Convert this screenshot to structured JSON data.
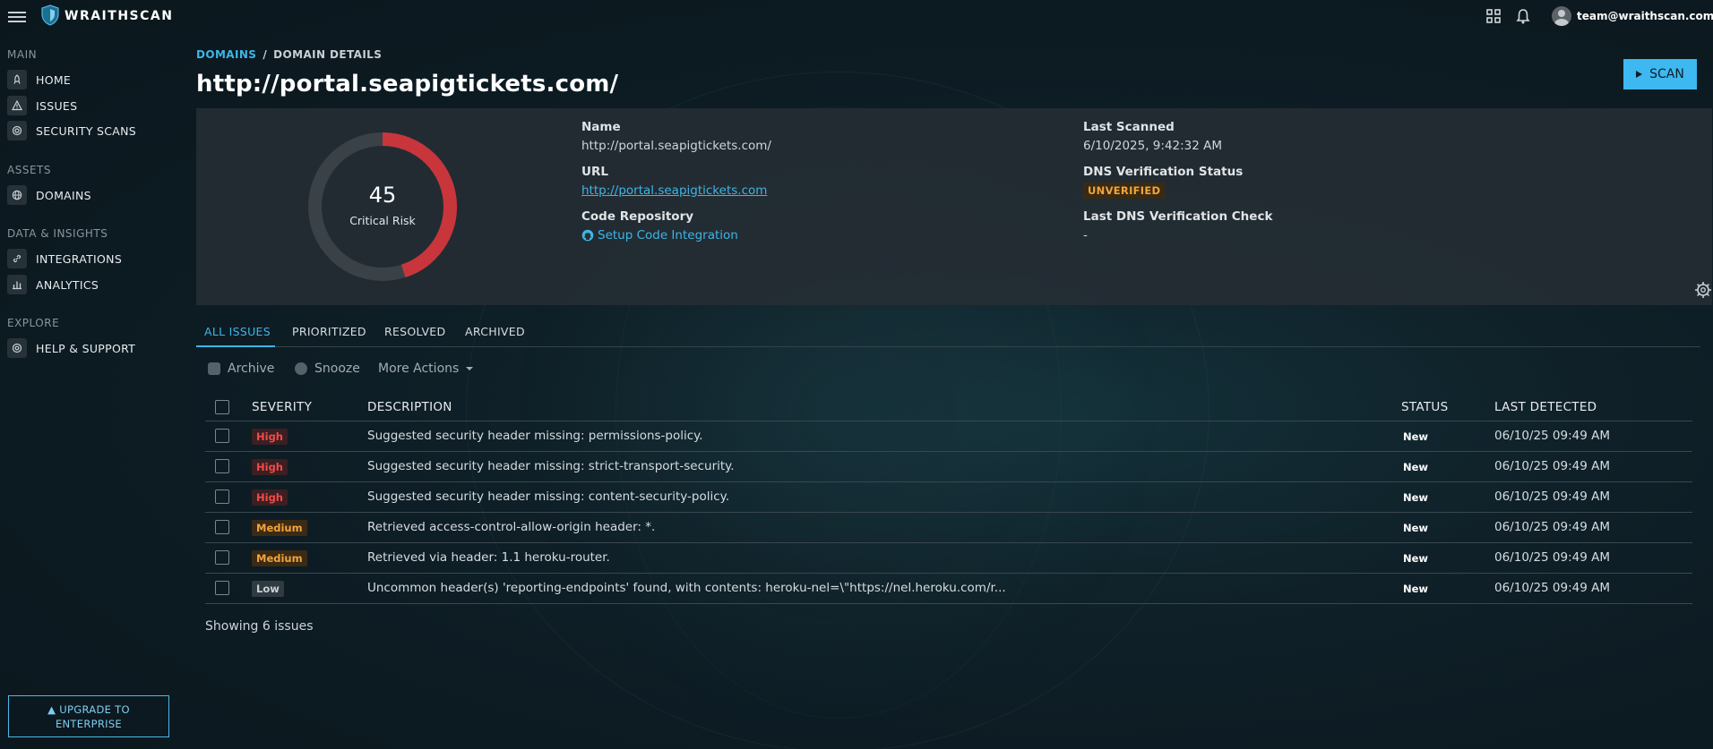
{
  "app": {
    "name": "WRAITHSCAN"
  },
  "header": {
    "user_email": "team@wraithscan.com",
    "icons": [
      "apps-grid-icon",
      "bell-icon",
      "user-avatar-icon"
    ]
  },
  "sidebar": {
    "sections": [
      {
        "title": "MAIN",
        "items": [
          {
            "label": "HOME",
            "icon": "rocket-icon"
          },
          {
            "label": "ISSUES",
            "icon": "warning-icon"
          },
          {
            "label": "SECURITY SCANS",
            "icon": "target-icon"
          }
        ]
      },
      {
        "title": "ASSETS",
        "items": [
          {
            "label": "DOMAINS",
            "icon": "globe-icon"
          }
        ]
      },
      {
        "title": "DATA & INSIGHTS",
        "items": [
          {
            "label": "INTEGRATIONS",
            "icon": "link-icon"
          },
          {
            "label": "ANALYTICS",
            "icon": "bar-chart-icon"
          }
        ]
      },
      {
        "title": "EXPLORE",
        "items": [
          {
            "label": "HELP & SUPPORT",
            "icon": "lifebuoy-icon"
          }
        ]
      }
    ],
    "upgrade": {
      "line1": "UPGRADE TO",
      "line2": "ENTERPRISE"
    }
  },
  "breadcrumb": {
    "parent": "DOMAINS",
    "separator": "/",
    "current": "DOMAIN DETAILS"
  },
  "page_title": "http://portal.seapigtickets.com/",
  "scan_button": "SCAN",
  "risk": {
    "score": "45",
    "label": "Critical Risk",
    "fraction": 0.45,
    "color": "#c8363b",
    "track_color": "#3a4247"
  },
  "details": {
    "name_label": "Name",
    "name_value": "http://portal.seapigtickets.com/",
    "url_label": "URL",
    "url_value": "http://portal.seapigtickets.com",
    "repo_label": "Code Repository",
    "repo_link": "Setup Code Integration",
    "last_scanned_label": "Last Scanned",
    "last_scanned_value": "6/10/2025, 9:42:32 AM",
    "dns_status_label": "DNS Verification Status",
    "dns_status_value": "UNVERIFIED",
    "dns_check_label": "Last DNS Verification Check",
    "dns_check_value": "-"
  },
  "tabs": [
    "ALL ISSUES",
    "PRIORITIZED",
    "RESOLVED",
    "ARCHIVED"
  ],
  "actions": {
    "archive": "Archive",
    "snooze": "Snooze",
    "more": "More Actions"
  },
  "table": {
    "headers": {
      "severity": "SEVERITY",
      "description": "DESCRIPTION",
      "status": "STATUS",
      "last_detected": "LAST DETECTED"
    },
    "rows": [
      {
        "severity": "High",
        "level": "high",
        "description": "Suggested security header missing: permissions-policy.",
        "status": "New",
        "last_detected": "06/10/25 09:49 AM"
      },
      {
        "severity": "High",
        "level": "high",
        "description": "Suggested security header missing: strict-transport-security.",
        "status": "New",
        "last_detected": "06/10/25 09:49 AM"
      },
      {
        "severity": "High",
        "level": "high",
        "description": "Suggested security header missing: content-security-policy.",
        "status": "New",
        "last_detected": "06/10/25 09:49 AM"
      },
      {
        "severity": "Medium",
        "level": "medium",
        "description": "Retrieved access-control-allow-origin header: *.",
        "status": "New",
        "last_detected": "06/10/25 09:49 AM"
      },
      {
        "severity": "Medium",
        "level": "medium",
        "description": "Retrieved via header: 1.1 heroku-router.",
        "status": "New",
        "last_detected": "06/10/25 09:49 AM"
      },
      {
        "severity": "Low",
        "level": "low",
        "description": "Uncommon header(s) 'reporting-endpoints' found, with contents: heroku-nel=\\\"https://nel.heroku.com/r...",
        "status": "New",
        "last_detected": "06/10/25 09:49 AM"
      }
    ],
    "footer": "Showing 6 issues"
  }
}
